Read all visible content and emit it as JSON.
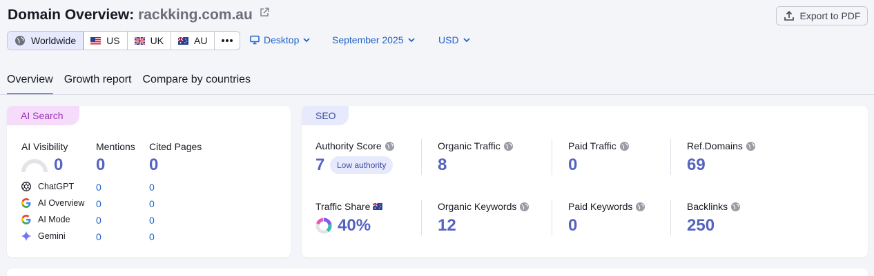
{
  "header": {
    "title_prefix": "Domain Overview:",
    "domain": "rackking.com.au",
    "export_label": "Export to PDF"
  },
  "regions": [
    {
      "label": "Worldwide",
      "icon": "globe-icon",
      "active": true
    },
    {
      "label": "US",
      "icon": "us-flag-icon"
    },
    {
      "label": "UK",
      "icon": "uk-flag-icon"
    },
    {
      "label": "AU",
      "icon": "au-flag-icon"
    }
  ],
  "filters": {
    "device": "Desktop",
    "date": "September 2025",
    "currency": "USD"
  },
  "tabs": [
    "Overview",
    "Growth report",
    "Compare by countries"
  ],
  "ai_search": {
    "tag": "AI Search",
    "visibility_label": "AI Visibility",
    "visibility_value": "0",
    "mentions_label": "Mentions",
    "mentions_value": "0",
    "cited_label": "Cited Pages",
    "cited_value": "0",
    "engines": [
      {
        "name": "ChatGPT",
        "mentions": "0",
        "cited": "0"
      },
      {
        "name": "AI Overview",
        "mentions": "0",
        "cited": "0"
      },
      {
        "name": "AI Mode",
        "mentions": "0",
        "cited": "0"
      },
      {
        "name": "Gemini",
        "mentions": "0",
        "cited": "0"
      }
    ]
  },
  "seo": {
    "tag": "SEO",
    "authority_label": "Authority Score",
    "authority_value": "7",
    "authority_badge": "Low authority",
    "organic_traffic_label": "Organic Traffic",
    "organic_traffic_value": "8",
    "paid_traffic_label": "Paid Traffic",
    "paid_traffic_value": "0",
    "ref_domains_label": "Ref.Domains",
    "ref_domains_value": "69",
    "traffic_share_label": "Traffic Share",
    "traffic_share_value": "40%",
    "traffic_share_fraction": 0.4,
    "organic_keywords_label": "Organic Keywords",
    "organic_keywords_value": "12",
    "paid_keywords_label": "Paid Keywords",
    "paid_keywords_value": "0",
    "backlinks_label": "Backlinks",
    "backlinks_value": "250"
  },
  "colors": {
    "accent": "#5563c1",
    "link": "#1e61c8",
    "ai_tag_bg": "#f6dcfb",
    "ai_tag_text": "#9a2fb9",
    "seo_tag_bg": "#e6eafc",
    "seo_tag_text": "#3f4d9e"
  }
}
